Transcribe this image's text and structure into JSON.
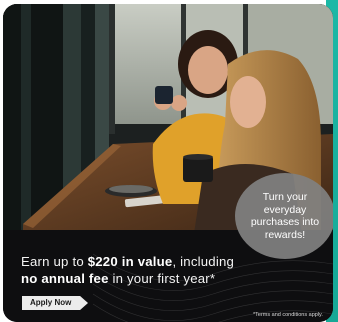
{
  "ad": {
    "bubble_text": "Turn your everyday purchases into rewards!",
    "headline": {
      "part1": "Earn up to ",
      "amount": "$220 in value",
      "part2": ", including",
      "fee": "no annual fee",
      "part3": " in your first year*"
    },
    "apply_label": "Apply Now",
    "terms": "*Terms and conditions apply."
  },
  "colors": {
    "accent_teal": "#1bb8a6",
    "card_background": "#0e0e10",
    "bubble": "#808080"
  }
}
